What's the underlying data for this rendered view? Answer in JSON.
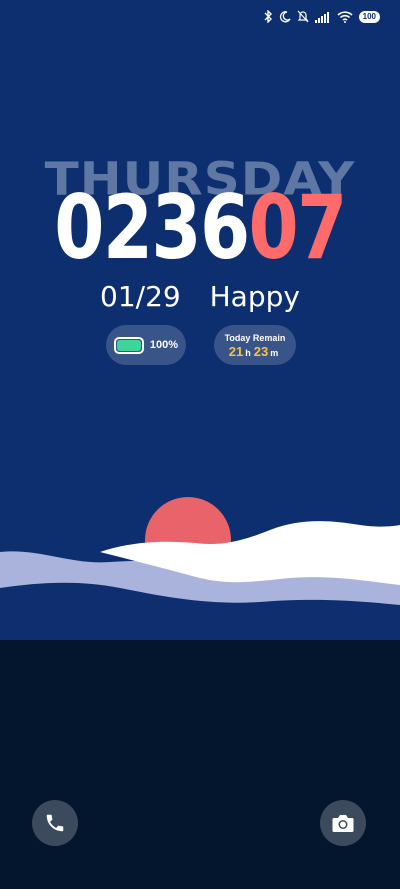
{
  "status_bar": {
    "icons": [
      "bluetooth-icon",
      "moon-icon",
      "bell-off-icon",
      "signal-icon",
      "wifi-icon"
    ],
    "battery_level": "100"
  },
  "clock": {
    "day": "THURSDAY",
    "hours_minutes": "0236",
    "seconds": "07"
  },
  "date_row": {
    "date": "01/29",
    "mood": "Happy"
  },
  "battery_widget": {
    "percent_text": "100%",
    "level": 1.0
  },
  "remain_widget": {
    "title": "Today Remain",
    "hours": "21",
    "hours_unit": "h",
    "minutes": "23",
    "minutes_unit": "m"
  },
  "shortcuts": {
    "left": "phone-icon",
    "right": "camera-icon"
  },
  "colors": {
    "sky": "#0d2f70",
    "ground": "#04162d",
    "sun": "#e8636a",
    "accent_seconds": "#ff6b6b",
    "accent_remain": "#f6c343",
    "battery_fill": "#3cd69d"
  }
}
